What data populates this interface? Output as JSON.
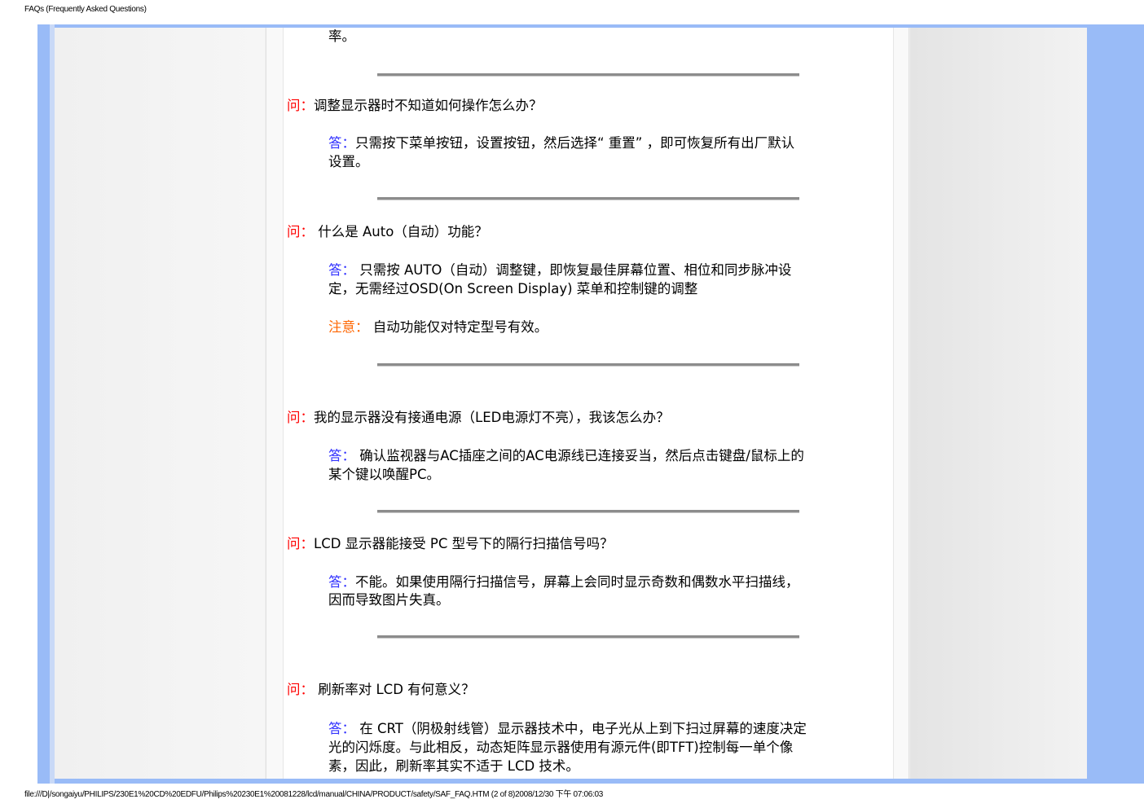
{
  "header": {
    "title": "FAQs (Frequently Asked Questions)"
  },
  "footer": {
    "path": "file:///D|/songaiyu/PHILIPS/230E1%20CD%20EDFU/Philips%20230E1%20081228/lcd/manual/CHINA/PRODUCT/safety/SAF_FAQ.HTM (2 of 8)2008/12/30 下午 07:06:03"
  },
  "faq": {
    "prev_tail": "率。",
    "q1": {
      "q_label": "问：",
      "q_text": "调整显示器时不知道如何操作怎么办？",
      "a_label": "答：",
      "a_line1": "只需按下菜单按钮，设置按钮，然后选择“ 重置”  ，即可恢复所有出厂默认",
      "a_line2": "设置。"
    },
    "q2": {
      "q_label": "问：",
      "q_text": " 什么是 Auto（自动）功能？",
      "a_label": "答：",
      "a_line1": " 只需按 AUTO（自动）调整键，即恢复最佳屏幕位置、相位和同步脉冲设",
      "a_line2": "定，无需经过OSD(On Screen Display)  菜单和控制键的调整",
      "n_label": "注意：",
      "n_text": " 自动功能仅对特定型号有效。"
    },
    "q3": {
      "q_label": "问：",
      "q_text": "我的显示器没有接通电源（LED电源灯不亮），我该怎么办？",
      "a_label": "答：",
      "a_line1": " 确认监视器与AC插座之间的AC电源线已连接妥当，然后点击键盘/鼠标上的",
      "a_line2": "某个键以唤醒PC。"
    },
    "q4": {
      "q_label": "问：",
      "q_text": "LCD 显示器能接受 PC 型号下的隔行扫描信号吗？",
      "a_label": "答：",
      "a_line1": "不能。如果使用隔行扫描信号，屏幕上会同时显示奇数和偶数水平扫描线，",
      "a_line2": "因而导致图片失真。"
    },
    "q5": {
      "q_label": "问：",
      "q_text": " 刷新率对 LCD 有何意义？",
      "a_label": "答：",
      "a_line1": " 在 CRT（阴极射线管）显示器技术中，电子光从上到下扫过屏幕的速度决定",
      "a_line2": "光的闪烁度。与此相反，动态矩阵显示器使用有源元件(即TFT)控制每一单个像",
      "a_line3": "素，因此，刷新率其实不适于 LCD 技术。"
    }
  }
}
